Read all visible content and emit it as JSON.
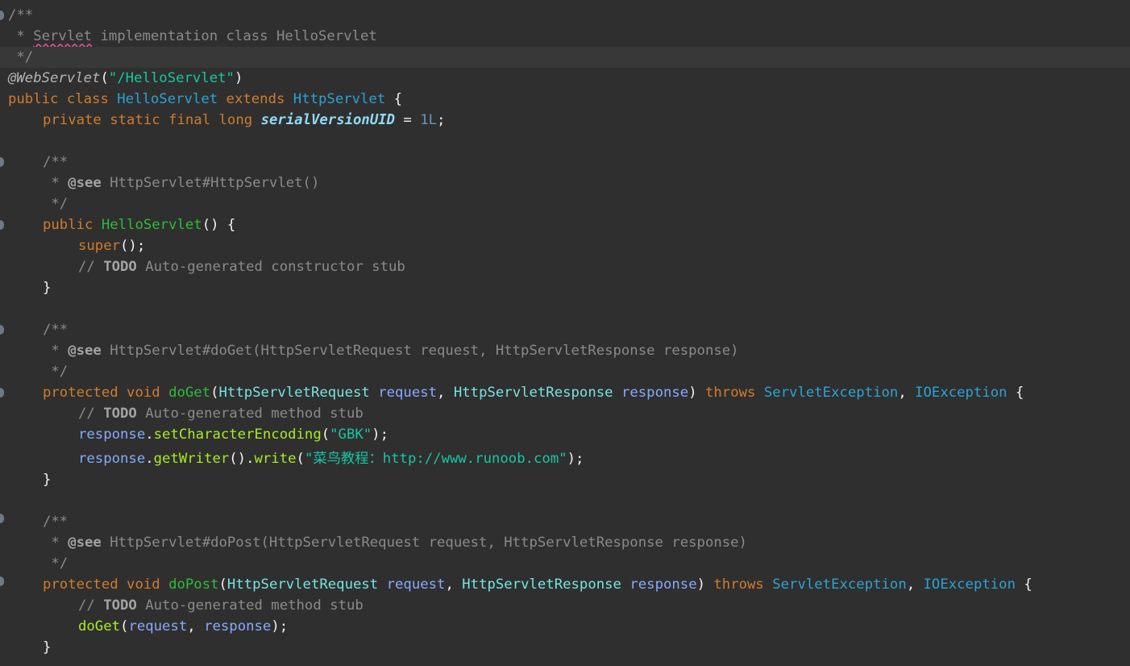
{
  "colors": {
    "background": "#2f2f2f",
    "current_line": "#383838",
    "comment": "#8a8a8a",
    "keyword": "#d27b2c",
    "class_name": "#2ba3d3",
    "type_ref": "#76e3e0",
    "parameter": "#88a9ff",
    "method_decl": "#2fbb3a",
    "method_call": "#a7ec21",
    "string": "#17c6a3",
    "number": "#6897bb",
    "static_field": "#8edbf5"
  },
  "code": {
    "l1": {
      "text": "/**"
    },
    "l2": {
      "star": " * ",
      "servlet": "Servlet",
      "rest": " implementation class HelloServlet"
    },
    "l3": {
      "text": " */"
    },
    "l4": {
      "annotation": "@WebServlet",
      "open": "(",
      "path": "\"/HelloServlet\"",
      "close": ")"
    },
    "l5": {
      "kw_public": "public",
      "kw_class": "class",
      "class_name": "HelloServlet",
      "kw_extends": "extends",
      "super_name": "HttpServlet",
      "brace": "{"
    },
    "l6": {
      "kw_private": "private",
      "kw_static": "static",
      "kw_final": "final",
      "kw_long": "long",
      "field": "serialVersionUID",
      "eq": " = ",
      "value": "1L",
      "semi": ";"
    },
    "l8": {
      "text": "/**"
    },
    "l9": {
      "star": " * ",
      "tag": "@see",
      "rest": " HttpServlet#HttpServlet()"
    },
    "l10": {
      "text": " */"
    },
    "l11": {
      "kw_public": "public",
      "ctor": "HelloServlet",
      "tail": "() {"
    },
    "l12": {
      "kw_super": "super",
      "tail": "();"
    },
    "l13": {
      "slashes": "// ",
      "todo": "TODO",
      "rest": " Auto-generated constructor stub"
    },
    "l14": {
      "brace": "}"
    },
    "l16": {
      "text": "/**"
    },
    "l17": {
      "star": " * ",
      "tag": "@see",
      "rest": " HttpServlet#doGet(HttpServletRequest request, HttpServletResponse response)"
    },
    "l18": {
      "text": " */"
    },
    "l19": {
      "kw_protected": "protected",
      "kw_void": "void",
      "method": "doGet",
      "open": "(",
      "type1": "HttpServletRequest",
      "param1": "request",
      "comma": ", ",
      "type2": "HttpServletResponse",
      "param2": "response",
      "close": ")",
      "kw_throws": "throws",
      "ex1": "ServletException",
      "comma2": ", ",
      "ex2": "IOException",
      "brace": "{"
    },
    "l20": {
      "slashes": "// ",
      "todo": "TODO",
      "rest": " Auto-generated method stub"
    },
    "l21": {
      "obj": "response",
      "dot": ".",
      "call": "setCharacterEncoding",
      "open": "(",
      "arg": "\"GBK\"",
      "close": ");"
    },
    "l22": {
      "obj": "response",
      "dot1": ".",
      "call1": "getWriter",
      "mid": "().",
      "call2": "write",
      "open": "(",
      "arg": "\"菜鸟教程：http://www.runoob.com\"",
      "close": ");"
    },
    "l23": {
      "brace": "}"
    },
    "l25": {
      "text": "/**"
    },
    "l26": {
      "star": " * ",
      "tag": "@see",
      "rest": " HttpServlet#doPost(HttpServletRequest request, HttpServletResponse response)"
    },
    "l27": {
      "text": " */"
    },
    "l28": {
      "kw_protected": "protected",
      "kw_void": "void",
      "method": "doPost",
      "open": "(",
      "type1": "HttpServletRequest",
      "param1": "request",
      "comma": ", ",
      "type2": "HttpServletResponse",
      "param2": "response",
      "close": ")",
      "kw_throws": "throws",
      "ex1": "ServletException",
      "comma2": ", ",
      "ex2": "IOException",
      "brace": "{"
    },
    "l29": {
      "slashes": "// ",
      "todo": "TODO",
      "rest": " Auto-generated method stub"
    },
    "l30": {
      "call": "doGet",
      "open": "(",
      "arg1": "request",
      "comma": ", ",
      "arg2": "response",
      "close": ");"
    },
    "l31": {
      "brace": "}"
    }
  }
}
